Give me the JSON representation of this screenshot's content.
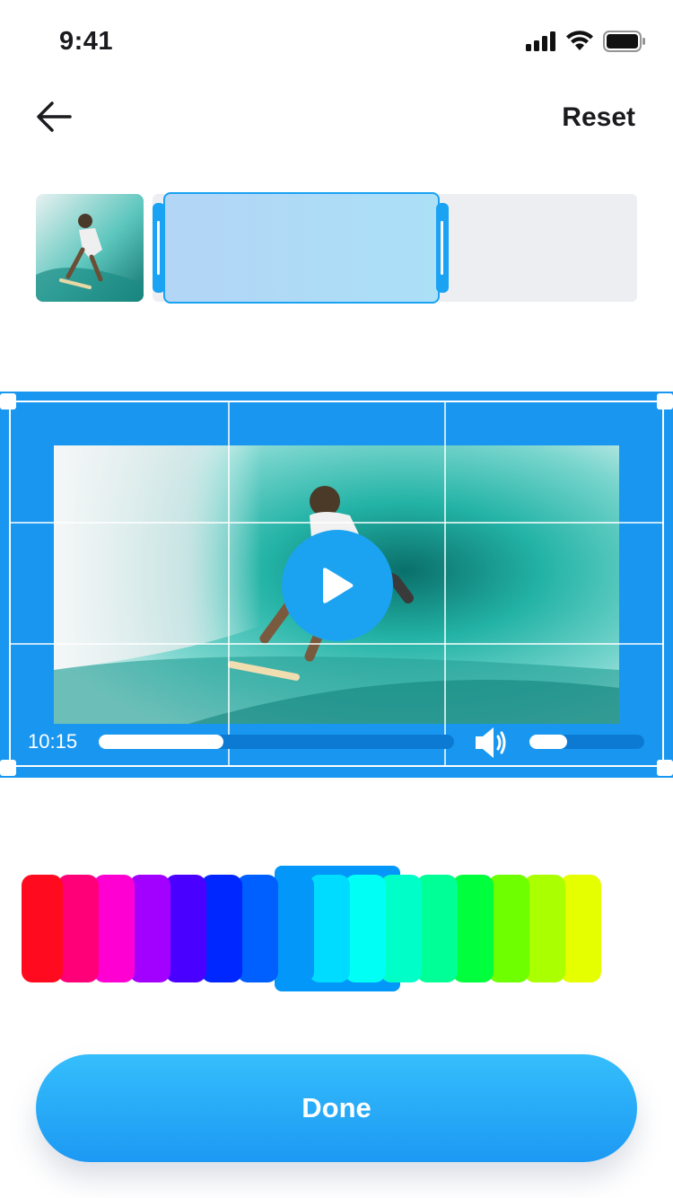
{
  "status_bar": {
    "time": "9:41"
  },
  "nav": {
    "reset_label": "Reset"
  },
  "timeline": {
    "selection_start": 0.02,
    "selection_end": 0.59
  },
  "player": {
    "current_time": "10:15",
    "progress": 0.35,
    "volume": 0.33
  },
  "palette": {
    "colors": [
      "#ff0a1e",
      "#ff0078",
      "#ff00d2",
      "#a200ff",
      "#4a00ff",
      "#0027ff",
      "#0060ff",
      "#0297f9",
      "#00dcff",
      "#00fff5",
      "#00ffc8",
      "#00ff96",
      "#00ff3c",
      "#6eff00",
      "#aaff00",
      "#e6ff00"
    ],
    "selected": "#0297f9"
  },
  "actions": {
    "done_label": "Done"
  },
  "colors": {
    "accent": "#1997f0",
    "button_gradient_top": "#35befc",
    "button_gradient_bottom": "#1c99f3"
  }
}
